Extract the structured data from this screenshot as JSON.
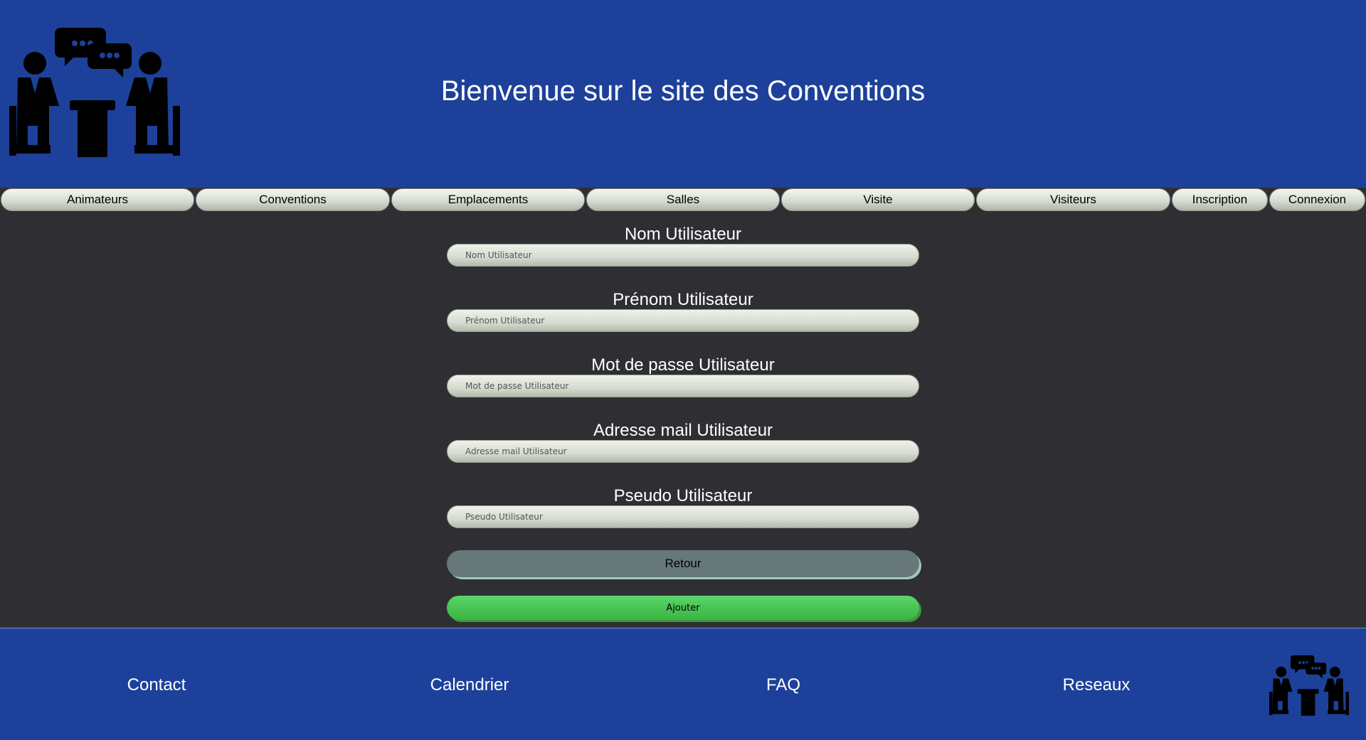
{
  "header": {
    "title": "Bienvenue sur le site des Conventions",
    "logo_icon": "conference-meeting-icon"
  },
  "nav": {
    "items": [
      {
        "label": "Animateurs"
      },
      {
        "label": "Conventions"
      },
      {
        "label": "Emplacements"
      },
      {
        "label": "Salles"
      },
      {
        "label": "Visite"
      },
      {
        "label": "Visiteurs"
      },
      {
        "label": "Inscription"
      },
      {
        "label": "Connexion"
      }
    ]
  },
  "form": {
    "fields": [
      {
        "label": "Nom Utilisateur",
        "placeholder": "Nom Utilisateur",
        "value": ""
      },
      {
        "label": "Prénom Utilisateur",
        "placeholder": "Prénom Utilisateur",
        "value": ""
      },
      {
        "label": "Mot de passe Utilisateur",
        "placeholder": "Mot de passe Utilisateur",
        "value": ""
      },
      {
        "label": "Adresse mail Utilisateur",
        "placeholder": "Adresse mail Utilisateur",
        "value": ""
      },
      {
        "label": "Pseudo Utilisateur",
        "placeholder": "Pseudo Utilisateur",
        "value": ""
      }
    ],
    "back_label": "Retour",
    "submit_label": "Ajouter"
  },
  "footer": {
    "links": [
      {
        "label": "Contact"
      },
      {
        "label": "Calendrier"
      },
      {
        "label": "FAQ"
      },
      {
        "label": "Reseaux"
      }
    ],
    "logo_icon": "conference-meeting-icon"
  },
  "colors": {
    "header_bg": "#1d419a",
    "page_bg": "#2f2f33",
    "submit_green": "#4cc657",
    "back_gray": "#67787a"
  }
}
